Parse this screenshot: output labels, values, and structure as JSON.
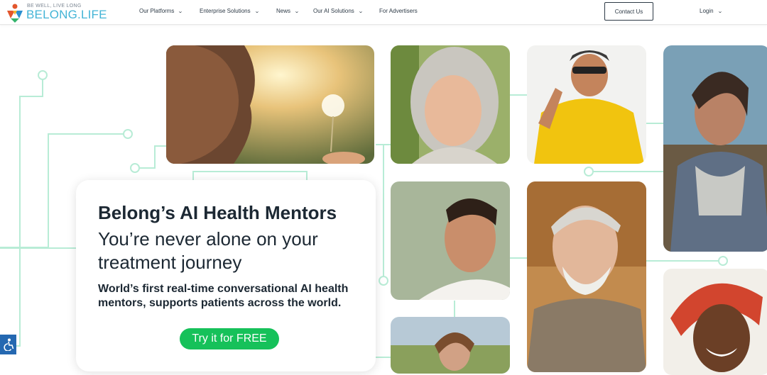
{
  "header": {
    "logo_tagline": "BE WELL, LIVE LONG",
    "logo_name": "BELONG.LIFE",
    "nav": [
      {
        "label": "Our Platforms",
        "icon": "chevron-down-icon"
      },
      {
        "label": "Enterprise Solutions",
        "icon": "chevron-down-icon"
      },
      {
        "label": "News",
        "icon": "chevron-down-icon"
      },
      {
        "label": "Our AI Solutions",
        "icon": "chevron-down-icon"
      },
      {
        "label": "For Advertisers"
      }
    ],
    "contact_label": "Contact Us",
    "login_label": "Login"
  },
  "hero": {
    "title": "Belong’s AI Health Mentors",
    "subtitle": "You’re never alone on your treatment journey",
    "description": "World’s first real-time conversational AI health mentors, supports patients across the world.",
    "cta_label": "Try it for FREE"
  },
  "colors": {
    "accent_green": "#16c15a",
    "logo_blue": "#43b4d6",
    "circuit_mint": "#9fe3c6",
    "accessibility_blue": "#2468b1"
  },
  "icons": [
    "chevron-down-icon",
    "accessibility-icon"
  ]
}
